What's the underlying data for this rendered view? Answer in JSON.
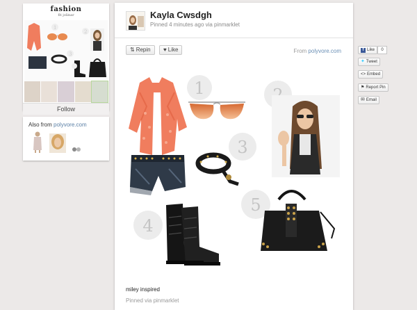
{
  "board": {
    "title": "fashion",
    "subtitle": "fit jolinar",
    "follow_label": "Follow"
  },
  "also_from": {
    "prefix": "Also from",
    "source": "polyvore.com"
  },
  "pin": {
    "pinner_name": "Kayla Cwsdgh",
    "meta": "Pinned 4 minutes ago via pinmarklet",
    "repin_label": "Repin",
    "like_label": "Like",
    "from_prefix": "From",
    "from_domain": "polyvore.com",
    "caption": "miley inspired",
    "pinned_via": "Pinned via pinmarklet",
    "collage_numbers": [
      "1",
      "2",
      "3",
      "4",
      "5"
    ]
  },
  "share": {
    "like_label": "Like",
    "like_count": "0",
    "tweet_label": "Tweet",
    "embed_label": "Embed",
    "report_label": "Report Pin",
    "email_label": "Email"
  },
  "colors": {
    "background": "#ece9e8",
    "card": "#ffffff",
    "link": "#6a8fb5",
    "cardigan": "#f07d5e"
  }
}
